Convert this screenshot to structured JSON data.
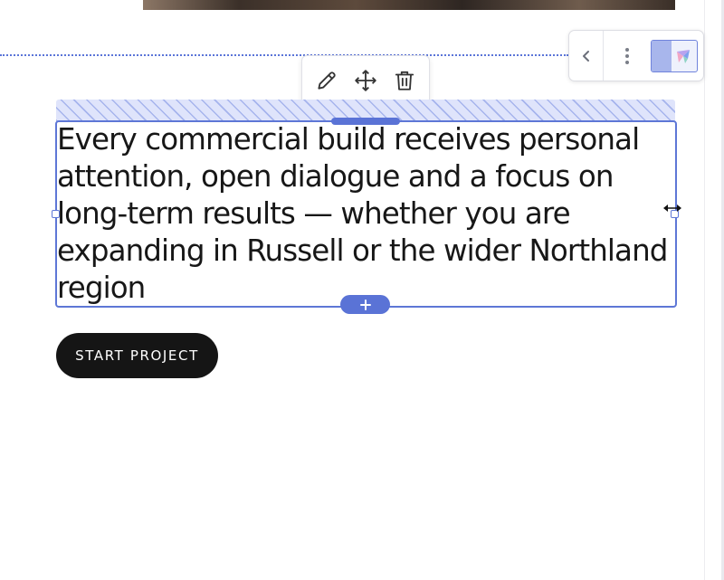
{
  "content": {
    "paragraph": "Every commercial build receives personal attention, open dialogue and a focus on long-term results — whether you are expanding in Russell or the wider Northland region",
    "cta_label": "START PROJECT"
  },
  "toolbar": {
    "tools": [
      "pencil-icon",
      "move-icon",
      "trash-icon"
    ]
  },
  "widget_panel": {
    "icons": [
      "chevron-left-icon",
      "more-vertical-icon",
      "app-logo"
    ]
  },
  "insert": {
    "symbol": "+"
  },
  "colors": {
    "accent": "#5a73d6",
    "selection_fill": "#dfe4fb",
    "text": "#171717",
    "button_bg": "#151515",
    "button_text": "#ffffff"
  }
}
